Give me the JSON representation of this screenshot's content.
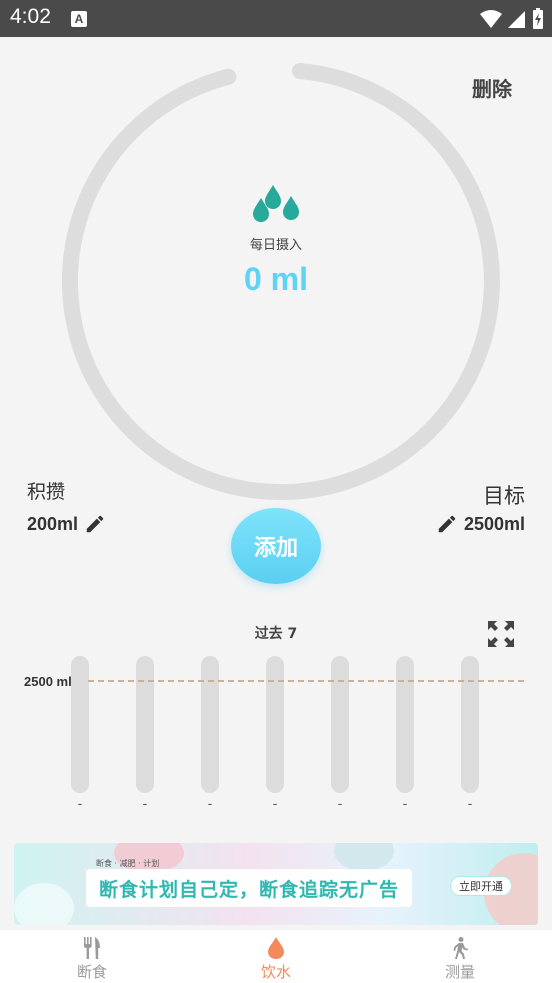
{
  "status_bar": {
    "time": "4:02",
    "notification_glyph": "A",
    "icons": [
      "wifi-icon",
      "signal-icon",
      "battery-charging-icon"
    ]
  },
  "header": {
    "delete_label": "删除"
  },
  "intake": {
    "label": "每日摄入",
    "value": "0 ml",
    "progress_fraction": 0,
    "icon": "water-drops-icon"
  },
  "accumulated": {
    "label": "积攒",
    "value": "200ml",
    "edit_icon": "pencil-icon"
  },
  "target": {
    "label": "目标",
    "value": "2500ml",
    "edit_icon": "pencil-icon"
  },
  "add_button": {
    "label": "添加"
  },
  "history": {
    "title": "过去 7",
    "target_line_label": "2500 ml",
    "expand_icon": "expand-icon",
    "days": [
      {
        "label": "-",
        "value": 0
      },
      {
        "label": "-",
        "value": 0
      },
      {
        "label": "-",
        "value": 0
      },
      {
        "label": "-",
        "value": 0
      },
      {
        "label": "-",
        "value": 0
      },
      {
        "label": "-",
        "value": 0
      },
      {
        "label": "-",
        "value": 0
      }
    ]
  },
  "ad": {
    "small_text": "断食 · 减肥 · 计划",
    "main_text": "断食计划自己定，断食追踪无广告",
    "button_label": "立即开通"
  },
  "tabbar": {
    "tabs": [
      {
        "label": "断食",
        "icon": "fork-knife-icon",
        "active": false
      },
      {
        "label": "饮水",
        "icon": "water-drop-icon",
        "active": true
      },
      {
        "label": "测量",
        "icon": "walking-person-icon",
        "active": false
      }
    ]
  },
  "colors": {
    "accent": "#5fd3f3",
    "drop": "#27a99c",
    "ring_track": "#dddddd",
    "tab_active": "#f28a5b",
    "tab_inactive": "#9a9a9a",
    "target_line": "#c9b192"
  }
}
